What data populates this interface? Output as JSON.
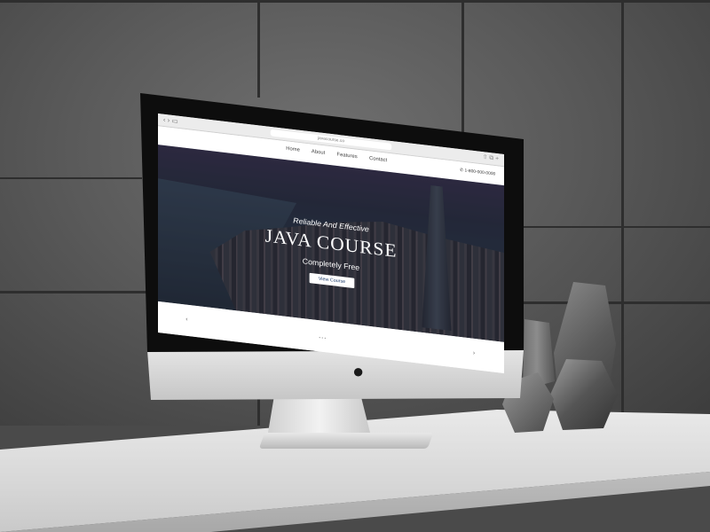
{
  "browser": {
    "url": "javacourse.co"
  },
  "site": {
    "nav": [
      "Home",
      "About",
      "Features",
      "Contact"
    ],
    "phone": "1-800-000-0000"
  },
  "hero": {
    "tagline": "Reliable And Effective",
    "title": "JAVA COURSE",
    "subtitle": "Completely Free",
    "button": "View Course"
  },
  "carousel": {
    "prev_icon": "‹",
    "next_icon": "›"
  },
  "colors": {
    "button_text": "#1a3a6a",
    "hero_overlay": "#2c3244"
  }
}
